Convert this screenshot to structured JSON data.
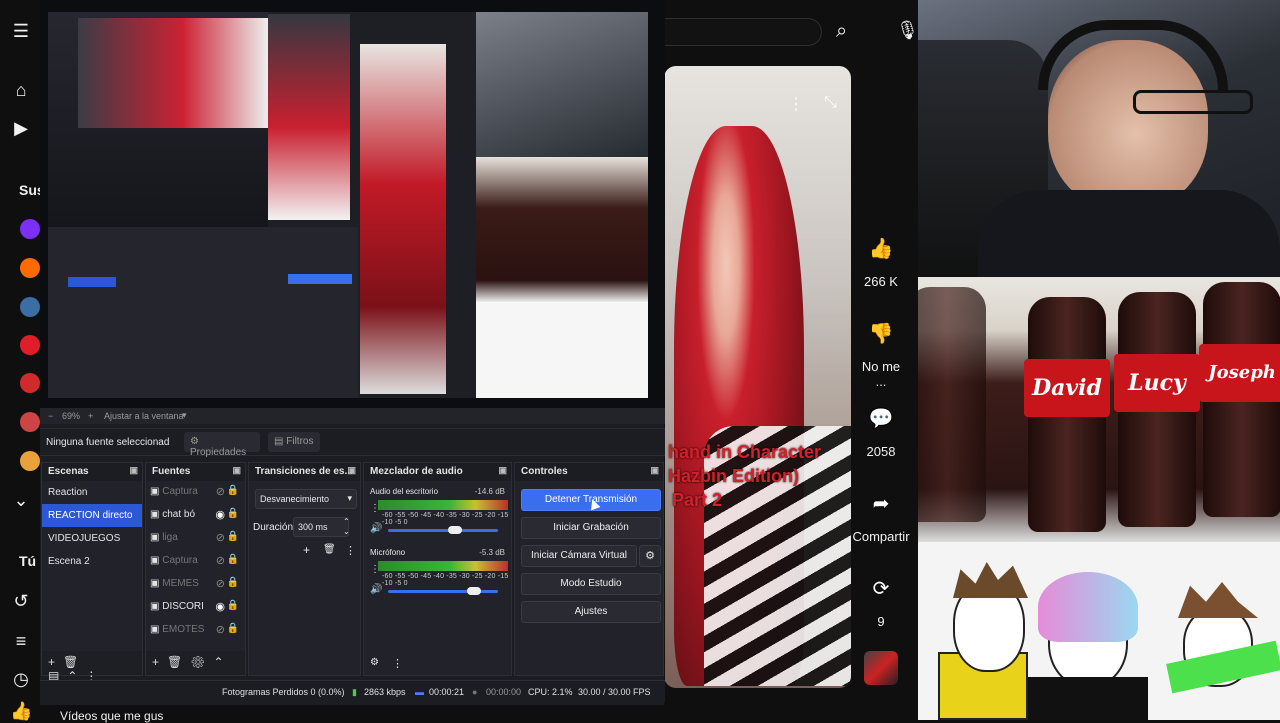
{
  "youtube": {
    "sidebar": {
      "subs_label": "Sus",
      "you_label": "Tú",
      "you_label2": "Tú",
      "channel_colors": [
        "#7b2ff7",
        "#ff6b00",
        "#3a6ea5",
        "#e11d2a",
        "#d12a2a",
        "#c44",
        "#e9a23b"
      ]
    },
    "short": {
      "overlay_line1": "hand in Character",
      "overlay_line2": "Hazbin Edition)",
      "overlay_line3": "Part 2",
      "like_count": "266 K",
      "dislike_label": "No me ...",
      "comments_count": "2058",
      "share_label": "Compartir",
      "remix_count": "9"
    },
    "bottom_text": "Vídeos que me gus"
  },
  "obs": {
    "zoom": "69%",
    "fit_label": "Ajustar a la ventana",
    "source_bar": {
      "selected_source": "Ninguna fuente seleccionad",
      "properties_label": "Propiedades",
      "filters_label": "Filtros"
    },
    "scenes": {
      "title": "Escenas",
      "items": [
        "Reaction",
        "REACTION directo",
        "VIDEOJUEGOS",
        "Escena 2"
      ],
      "selected_index": 1
    },
    "sources": {
      "title": "Fuentes",
      "items": [
        {
          "label": "Captura",
          "visible": false
        },
        {
          "label": "chat bó",
          "visible": true
        },
        {
          "label": "liga",
          "visible": false
        },
        {
          "label": "Captura",
          "visible": false
        },
        {
          "label": "MEMES",
          "visible": false
        },
        {
          "label": "DISCORI",
          "visible": true
        },
        {
          "label": "EMOTES",
          "visible": false
        }
      ]
    },
    "transitions": {
      "title": "Transiciones de es...",
      "selected": "Desvanecimiento",
      "duration_label": "Duración",
      "duration_value": "300 ms"
    },
    "mixer": {
      "title": "Mezclador de audio",
      "channels": [
        {
          "name": "Audio del escritorio",
          "db": "-14.6 dB",
          "volume": 0.62
        },
        {
          "name": "Micrófono",
          "db": "-5.3 dB",
          "volume": 0.82
        }
      ],
      "scale": "-60 -55 -50 -45 -40 -35 -30 -25 -20 -15 -10 -5 0"
    },
    "controls": {
      "title": "Controles",
      "buttons": [
        "Detener Transmisión",
        "Iniciar Grabación",
        "Iniciar Cámara Virtual",
        "Modo Estudio",
        "Ajustes"
      ]
    },
    "status": {
      "dropped_frames": "Fotogramas Perdidos 0 (0.0%)",
      "bitrate": "2863 kbps",
      "stream_time": "00:00:21",
      "rec_time": "00:00:00",
      "cpu": "CPU: 2.1%",
      "fps": "30.00 / 30.00 FPS"
    }
  },
  "colors": {
    "obs_accent": "#3a6df0",
    "youtube_bg": "#0f0f0f",
    "title_red": "#d4202a"
  }
}
